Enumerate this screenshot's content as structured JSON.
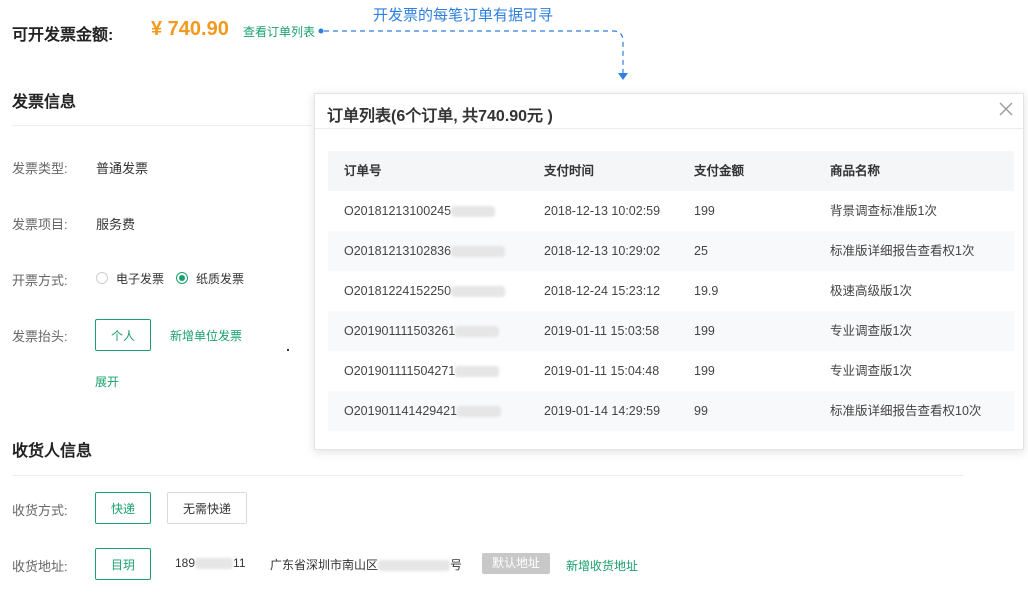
{
  "header": {
    "amount_label": "可开发票金额:",
    "amount_value": "¥ 740.90",
    "view_orders_link": "查看订单列表",
    "annotation": "开发票的每笔订单有据可寻"
  },
  "invoice_section": {
    "title": "发票信息",
    "type_label": "发票类型:",
    "type_value": "普通发票",
    "item_label": "发票项目:",
    "item_value": "服务费",
    "method_label": "开票方式:",
    "method_options": [
      {
        "label": "电子发票",
        "checked": false
      },
      {
        "label": "纸质发票",
        "checked": true
      }
    ],
    "title_label": "发票抬头:",
    "personal_button": "个人",
    "add_company_link": "新增单位发票",
    "expand_link": "展开"
  },
  "receiver_section": {
    "title": "收货人信息",
    "delivery_label": "收货方式:",
    "delivery_options": [
      "快递",
      "无需快递"
    ],
    "address_label": "收货地址:",
    "address_name_button": "目玥",
    "phone_prefix": "189",
    "phone_suffix": "11",
    "address_prefix": "广东省深圳市南山区",
    "address_suffix": "号",
    "default_badge": "默认地址",
    "add_address_link": "新增收货地址"
  },
  "modal": {
    "title": "订单列表(6个订单, 共740.90元 )",
    "close_icon": "close-icon",
    "columns": [
      "订单号",
      "支付时间",
      "支付金额",
      "商品名称"
    ],
    "rows": [
      {
        "order_no": "O20181213100245",
        "time": "2018-12-13 10:02:59",
        "amount": "199",
        "product": "背景调查标准版1次"
      },
      {
        "order_no": "O20181213102836",
        "time": "2018-12-13 10:29:02",
        "amount": "25",
        "product": "标准版详细报告查看权1次"
      },
      {
        "order_no": "O20181224152250",
        "time": "2018-12-24 15:23:12",
        "amount": "19.9",
        "product": "极速高级版1次"
      },
      {
        "order_no": "O201901111503261",
        "time": "2019-01-11 15:03:58",
        "amount": "199",
        "product": "专业调查版1次"
      },
      {
        "order_no": "O201901111504271",
        "time": "2019-01-11 15:04:48",
        "amount": "199",
        "product": "专业调查版1次"
      },
      {
        "order_no": "O201901141429421",
        "time": "2019-01-14 14:29:59",
        "amount": "99",
        "product": "标准版详细报告查看权10次"
      }
    ]
  },
  "colors": {
    "accent_green": "#1aa06d",
    "amount_orange": "#f39a1e",
    "annotation_blue": "#2f7fe0"
  }
}
